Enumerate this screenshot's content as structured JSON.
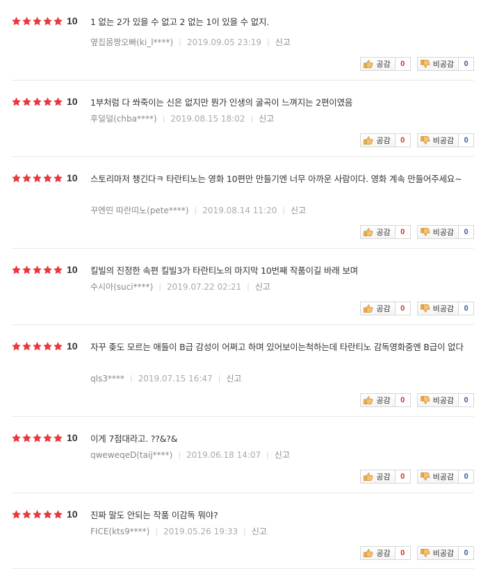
{
  "theme": {
    "star_color": "#e8383d",
    "like_color": "#d2272a",
    "dislike_color": "#3d5a98"
  },
  "labels": {
    "like": "공감",
    "dislike": "비공감",
    "report": "신고"
  },
  "reviews": [
    {
      "score": "10",
      "text": "1 없는 2가 있을 수 없고 2 없는 1이 있을 수 없지.",
      "nick": "옆집몸짱오빠(ki_l****)",
      "date": "2019.09.05 23:19",
      "likes": "0",
      "dislikes": "0"
    },
    {
      "score": "10",
      "text": "1부처럼 다 쏴죽이는 신은 없지만 뭔가 인생의 굴곡이 느껴지는 2편이였음",
      "nick": "후덜덜(chba****)",
      "date": "2019.08.15 18:02",
      "likes": "0",
      "dislikes": "0"
    },
    {
      "score": "10",
      "text": "스토리마저 챙긴다ㅋ 타란티노는 영화 10편만 만들기엔 너무 아까운 사람이다. 영화 계속 만들어주세요~",
      "nick": "꾸엔띤 따란띠노(pete****)",
      "date": "2019.08.14 11:20",
      "likes": "0",
      "dislikes": "0"
    },
    {
      "score": "10",
      "text": "킬빌의 진정한 속편 킬빌3가 타란티노의 마지막 10번째 작품이길 바래 보며",
      "nick": "수시아(suci****)",
      "date": "2019.07.22 02:21",
      "likes": "0",
      "dislikes": "0"
    },
    {
      "score": "10",
      "text": "자꾸 좆도 모르는 애들이 B급 감성이 어쩌고 하며 있어보이는척하는데 타란티노 감독영화중엔 B급이 없다",
      "nick": "qls3****",
      "date": "2019.07.15 16:47",
      "likes": "0",
      "dislikes": "0"
    },
    {
      "score": "10",
      "text": "이게 7점대라고. ??&?&",
      "nick": "qweweqeD(taij****)",
      "date": "2019.06.18 14:07",
      "likes": "0",
      "dislikes": "0"
    },
    {
      "score": "10",
      "text": "진짜 말도 안되는 작품 이감독 뭐야?",
      "nick": "FICE(kts9****)",
      "date": "2019.05.26 19:33",
      "likes": "0",
      "dislikes": "0"
    }
  ]
}
